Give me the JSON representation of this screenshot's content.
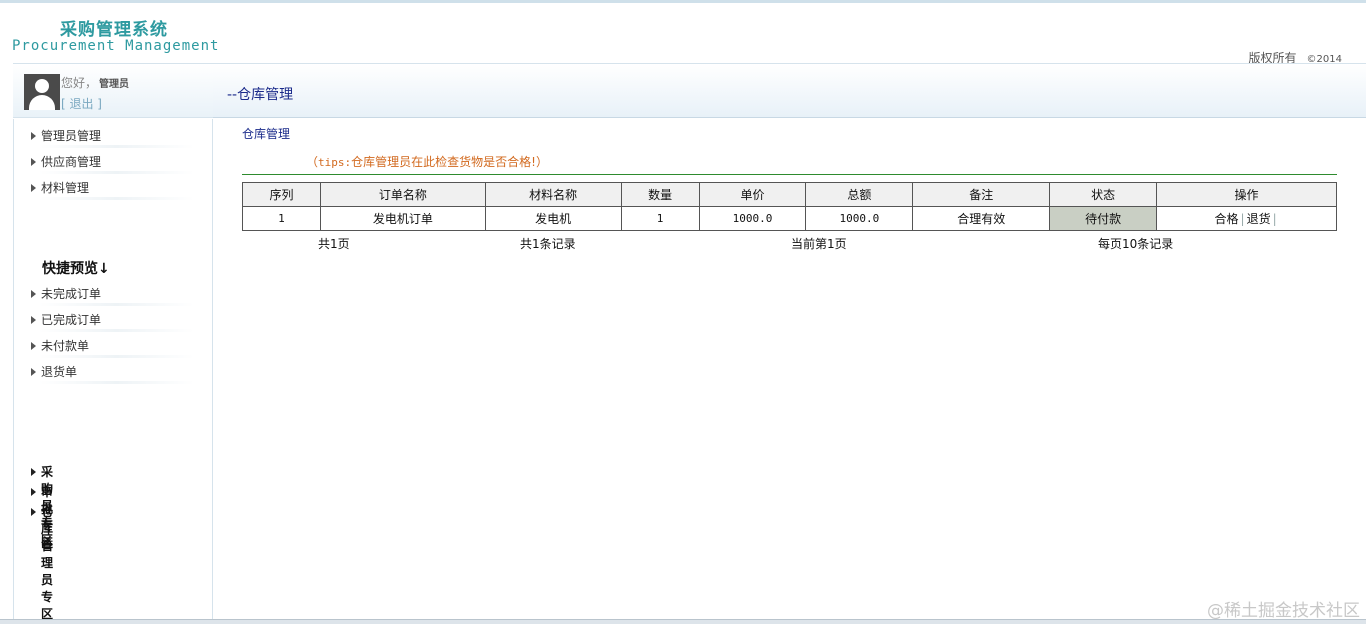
{
  "header": {
    "title_cn": "采购管理系统",
    "title_en": "Procurement Management",
    "copyright": "版权所有",
    "copyright_year": "©2014"
  },
  "user": {
    "greeting": "您好，",
    "name": "管理员",
    "logout": "[ 退出 ]"
  },
  "sidebar": {
    "items": [
      {
        "label": "管理员管理"
      },
      {
        "label": "供应商管理"
      },
      {
        "label": "材料管理"
      }
    ],
    "quick_title": "快捷预览↓",
    "quick_items": [
      {
        "label": "未完成订单"
      },
      {
        "label": "已完成订单"
      },
      {
        "label": "未付款单"
      },
      {
        "label": "退货单"
      }
    ],
    "zones": [
      {
        "label": "采购员专区"
      },
      {
        "label": "审批专区"
      },
      {
        "label": "仓库管理员专区"
      }
    ]
  },
  "main": {
    "breadcrumb": "--仓库管理",
    "section_title": "仓库管理",
    "tips_open": "（",
    "tips_prefix": "tips:",
    "tips_text": "仓库管理员在此检查货物是否合格!",
    "tips_close": "）",
    "table": {
      "headers": [
        "序列",
        "订单名称",
        "材料名称",
        "数量",
        "单价",
        "总额",
        "备注",
        "状态",
        "操作"
      ],
      "rows": [
        {
          "index": "1",
          "order_name": "发电机订单",
          "material": "发电机",
          "quantity": "1",
          "unit_price": "1000.0",
          "total": "1000.0",
          "remark": "合理有效",
          "status": "待付款",
          "action_pass": "合格",
          "action_return": "退货",
          "sep": "|"
        }
      ]
    },
    "pager": {
      "pages": "共1页",
      "records": "共1条记录",
      "current": "当前第1页",
      "per_page": "每页10条记录"
    }
  },
  "watermark": "@稀土掘金技术社区",
  "colors": {
    "brand": "#2e9aa0",
    "nav_text": "#1a2a8a",
    "tips": "#d2691e",
    "rule": "#2e8b2e",
    "status_bg": "#c9cfc4"
  }
}
